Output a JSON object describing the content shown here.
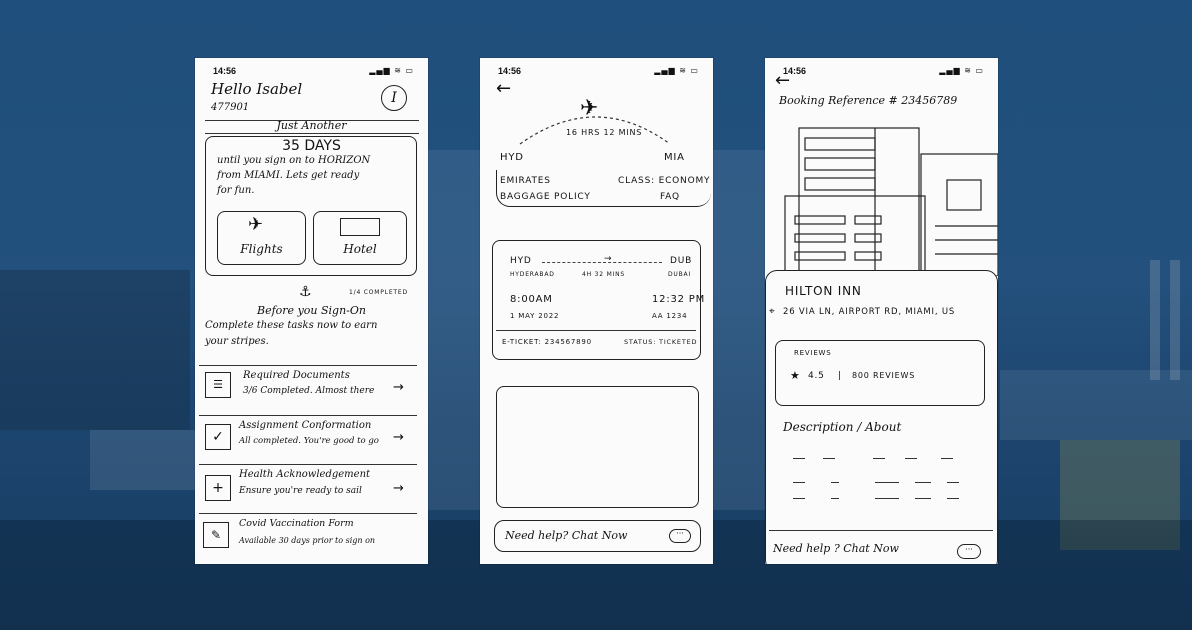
{
  "screen1": {
    "time": "14:56",
    "status_icons": "▂▄▆ ≋ ▭",
    "greeting": "Hello Isabel",
    "user_id": "477901",
    "avatar_initial": "I",
    "banner_title": "Just Another",
    "days_count": "35 DAYS",
    "countdown_text_1": "until you sign on to HORIZON",
    "countdown_text_2": "from MIAMI. Lets get ready",
    "countdown_text_3": "for fun.",
    "flights_label": "Flights",
    "hotel_label": "Hotel",
    "progress": "1/4 COMPLETED",
    "section_title": "Before you Sign-On",
    "section_sub_1": "Complete these tasks now to earn",
    "section_sub_2": "your stripes.",
    "tasks": [
      {
        "title": "Required Documents",
        "status": "3/6 Completed. Almost there"
      },
      {
        "title": "Assignment Conformation",
        "status": "All completed. You're good to go"
      },
      {
        "title": "Health Acknowledgement",
        "status": "Ensure you're ready to sail"
      },
      {
        "title": "Covid Vaccination Form",
        "status": "Available 30 days prior to sign on"
      }
    ]
  },
  "screen2": {
    "time": "14:56",
    "status_icons": "▂▄▆ ≋ ▭",
    "duration": "16 HRS 12 MINS",
    "origin": "HYD",
    "destination": "MIA",
    "airline": "EMIRATES",
    "class": "CLASS: ECONOMY",
    "baggage": "BAGGAGE POLICY",
    "faq": "FAQ",
    "leg_from": "HYD",
    "leg_to": "DUB",
    "leg_from_city": "HYDERABAD",
    "leg_duration": "4H 32 MINS",
    "leg_to_city": "DUBAI",
    "depart_time": "8:00AM",
    "arrive_time": "12:32 PM",
    "date": "1 MAY 2022",
    "flight_no": "AA 1234",
    "eticket": "E-TICKET: 234567890",
    "status": "STATUS: TICKETED",
    "help": "Need help? Chat Now"
  },
  "screen3": {
    "time": "14:56",
    "status_icons": "▂▄▆ ≋ ▭",
    "booking_ref": "Booking Reference # 23456789",
    "hotel_name": "HILTON INN",
    "address": "26 VIA LN, AIRPORT RD, MIAMI, US",
    "reviews_label": "REVIEWS",
    "rating": "4.5",
    "reviews_count": "800 REVIEWS",
    "description_title": "Description / About",
    "help": "Need help ? Chat Now"
  }
}
